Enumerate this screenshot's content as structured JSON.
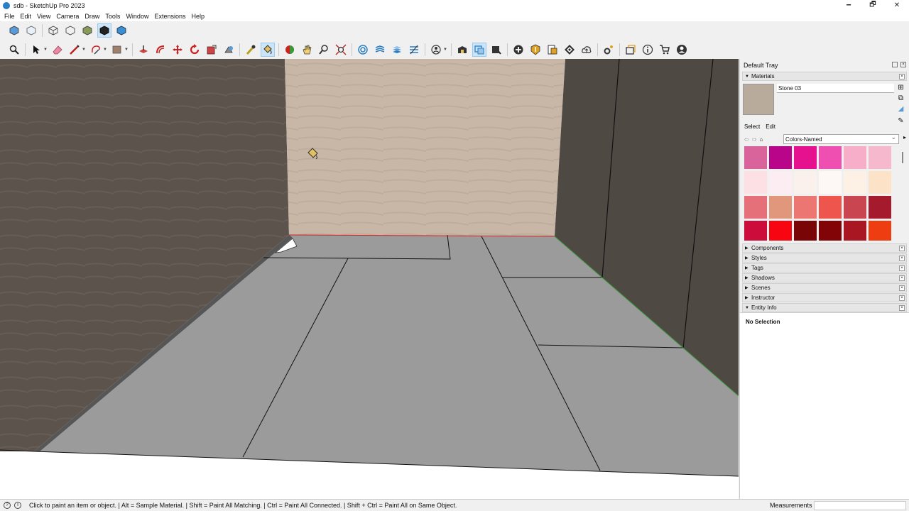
{
  "window": {
    "title": "sdb - SketchUp Pro 2023",
    "minimize": "🗕",
    "restore": "🗗",
    "close": "✕"
  },
  "menu": [
    "File",
    "Edit",
    "View",
    "Camera",
    "Draw",
    "Tools",
    "Window",
    "Extensions",
    "Help"
  ],
  "toolbar1": [
    "iso-view-icon",
    "xray-icon",
    "back-edges-icon",
    "wireframe-icon",
    "hidden-line-icon",
    "shaded-icon",
    "shaded-texture-icon"
  ],
  "toolbar2": [
    "search-icon",
    "select-icon",
    "eraser-icon",
    "line-icon",
    "shape-icon",
    "rectangle-icon",
    "push-pull-icon",
    "offset-icon",
    "move-icon",
    "rotate-icon",
    "scale-icon",
    "follow-me-icon",
    "tape-measure-icon",
    "paint-bucket-icon",
    "orbit-icon",
    "pan-icon",
    "zoom-icon",
    "zoom-extents-icon",
    "section-plane-icon",
    "layers-icon",
    "tags-icon",
    "outliner-icon",
    "style-builder-icon",
    "warehouse-icon",
    "component-icon",
    "scene-icon",
    "add-icon",
    "sandbox-icon",
    "generate-report-icon",
    "checker-icon",
    "cloud-icon",
    "settings-icon",
    "folder-icon",
    "info-icon",
    "cart-icon",
    "account-icon"
  ],
  "tray": {
    "title": "Default Tray",
    "materials_label": "Materials",
    "material_name": "Stone 03",
    "select_tab": "Select",
    "edit_tab": "Edit",
    "library": "Colors-Named",
    "swatches": [
      "#d9649b",
      "#b8058a",
      "#e6118f",
      "#ef4fb0",
      "#f7afc9",
      "#f5b8cc",
      "#fde0e4",
      "#fcedf2",
      "#fbf1ec",
      "#fdf8f5",
      "#fdf1e6",
      "#fce3c8",
      "#e5707a",
      "#e1977c",
      "#ec7672",
      "#ee564d",
      "#c94550",
      "#a51b2d",
      "#cc0c3b",
      "#f70511",
      "#7a0506",
      "#820406",
      "#a81722",
      "#ee3d10"
    ],
    "panels": [
      "Components",
      "Styles",
      "Tags",
      "Shadows",
      "Scenes",
      "Instructor",
      "Entity Info"
    ],
    "entity_info": "No Selection"
  },
  "status": {
    "text": "Click to paint an item or object. | Alt = Sample Material. | Shift = Paint All Matching. | Ctrl = Paint All Connected. | Shift + Ctrl = Paint All on Same Object.",
    "measurements_label": "Measurements"
  },
  "colors": {
    "wall": "#5b534c",
    "back_wall": "#c8b7a7",
    "floor": "#9b9b9b",
    "accent": "#2a7fc4"
  }
}
